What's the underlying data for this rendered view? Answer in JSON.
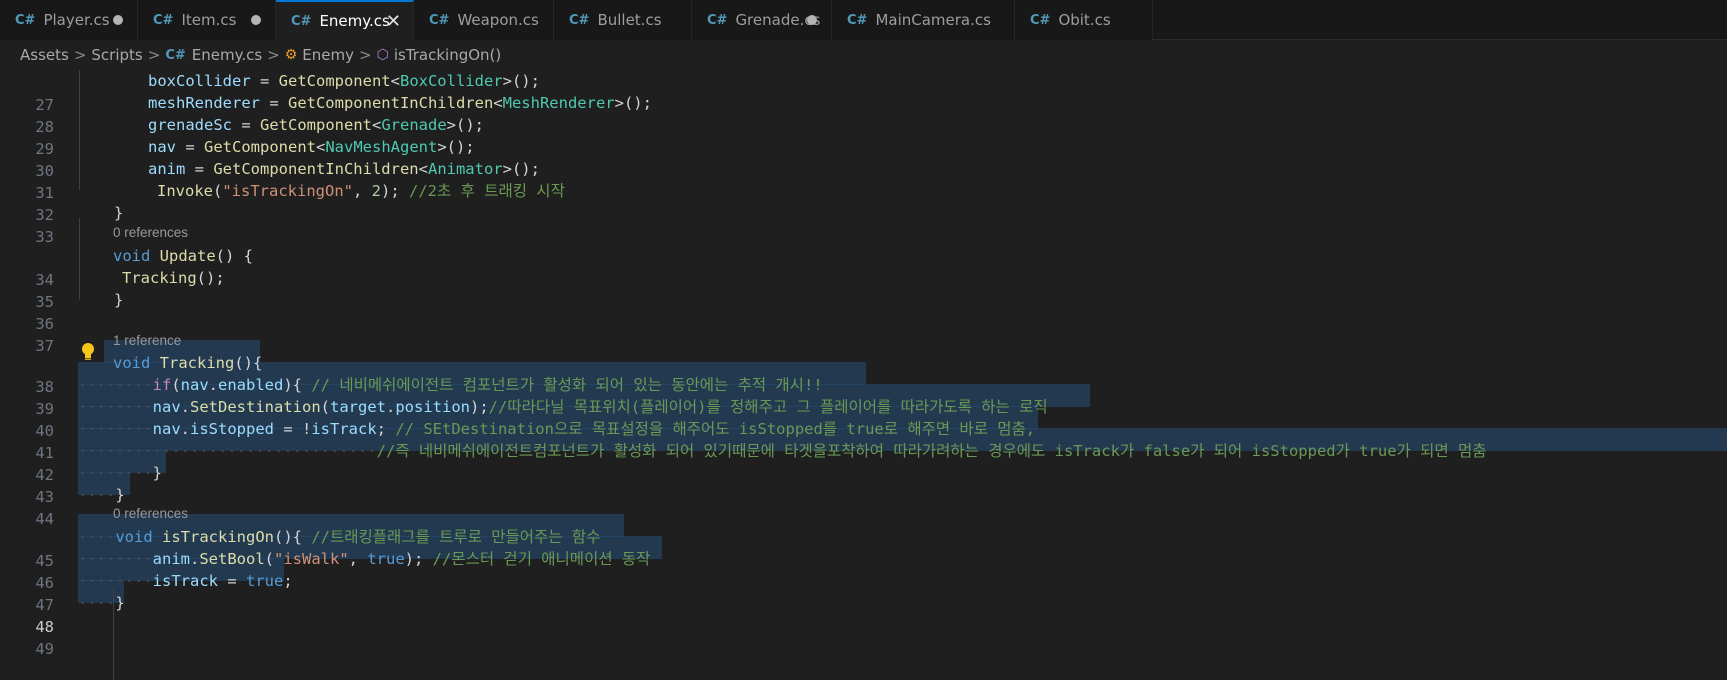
{
  "tabs": [
    {
      "label": "Player.cs",
      "state": "modified"
    },
    {
      "label": "Item.cs",
      "state": "modified"
    },
    {
      "label": "Enemy.cs",
      "state": "active"
    },
    {
      "label": "Weapon.cs",
      "state": "clean"
    },
    {
      "label": "Bullet.cs",
      "state": "clean"
    },
    {
      "label": "Grenade.cs",
      "state": "modified"
    },
    {
      "label": "MainCamera.cs",
      "state": "clean"
    },
    {
      "label": "Obit.cs",
      "state": "clean"
    }
  ],
  "breadcrumb": {
    "folder1": "Assets",
    "folder2": "Scripts",
    "file": "Enemy.cs",
    "class_name": "Enemy",
    "method": "isTrackingOn()"
  },
  "editor": {
    "current_line": "48",
    "line_numbers": {
      "l27": "27",
      "l28": "28",
      "l29": "29",
      "l30": "30",
      "l31": "31",
      "l32": "32",
      "l33": "33",
      "l34": "34",
      "l35": "35",
      "l36": "36",
      "l37": "37",
      "l38": "38",
      "l39": "39",
      "l40": "40",
      "l41": "41",
      "l42": "42",
      "l43": "43",
      "l44": "44",
      "l45": "45",
      "l46": "46",
      "l47": "47",
      "l48": "48",
      "l49": "49"
    },
    "codelens": {
      "above34": "0 references",
      "above38": "1 reference",
      "above45": "0 references"
    },
    "tokens": {
      "l27_var": "boxCollider",
      "l27_eq": " = ",
      "l27_fn": "GetComponent",
      "l27_lt": "<",
      "l27_type": "BoxCollider",
      "l27_end": ">();",
      "l28_var": "meshRenderer",
      "l28_eq": " = ",
      "l28_fn": "GetComponentInChildren",
      "l28_lt": "<",
      "l28_type": "MeshRenderer",
      "l28_end": ">();",
      "l29_var": "grenadeSc",
      "l29_eq": " = ",
      "l29_fn": "GetComponent",
      "l29_lt": "<",
      "l29_type": "Grenade",
      "l29_end": ">();",
      "l30_var": "nav",
      "l30_eq": " = ",
      "l30_fn": "GetComponent",
      "l30_lt": "<",
      "l30_type": "NavMeshAgent",
      "l30_end": ">();",
      "l31_var": "anim",
      "l31_eq": " = ",
      "l31_fn": "GetComponentInChildren",
      "l31_lt": "<",
      "l31_type": "Animator",
      "l31_end": ">();",
      "l32_fn": "Invoke",
      "l32_open": "(",
      "l32_str": "\"isTrackingOn\"",
      "l32_comma": ", ",
      "l32_num": "2",
      "l32_close": "); ",
      "l32_comment": "//2초 후 트래킹 시작",
      "l33_brace": "}",
      "l34_kw": "void",
      "l34_sp": " ",
      "l34_fn": "Update",
      "l34_rest": "() {",
      "l35_fn": "Tracking",
      "l35_rest": "();",
      "l36_brace": "}",
      "l38_kw": "void",
      "l38_sp": " ",
      "l38_fn": "Tracking",
      "l38_rest": "(){",
      "l39_ws": "········",
      "l39_kw": "if",
      "l39_open": "(",
      "l39_v1": "nav",
      "l39_dot": ".",
      "l39_v2": "enabled",
      "l39_close": "){ ",
      "l39_comment": "// 네비메쉬에이전트 컴포넌트가 활성화 되어 있는 동안에는 추적 개시!!",
      "l40_ws": "········",
      "l40_v1": "nav",
      "l40_dot": ".",
      "l40_fn": "SetDestination",
      "l40_open": "(",
      "l40_v2": "target",
      "l40_dot2": ".",
      "l40_v3": "position",
      "l40_close": ");",
      "l40_comment": "//따라다닐 목표위치(플레이어)를 정해주고 그 플레이어를 따라가도록 하는 로직",
      "l41_ws": "········",
      "l41_v1": "nav",
      "l41_dot": ".",
      "l41_v2": "isStopped",
      "l41_eq": " = !",
      "l41_v3": "isTrack",
      "l41_semi": "; ",
      "l41_comment": "// SEtDestination으로 목표설정을 해주어도 isStopped를 true로 해주면 바로 멈춤,",
      "l42_ws": "································",
      "l42_comment": "//즉 네비메쉬에이전트컴포넌트가 활성화 되어 있기때문에 타겟을포착하여 따라가려하는 경우에도 isTrack가 false가 되어 isStopped가 true가 되면 멈춤",
      "l43_ws": "········",
      "l43_brace": "}",
      "l44_ws": "····",
      "l44_brace": "}",
      "l45_ws": "····",
      "l45_kw": "void",
      "l45_sp": " ",
      "l45_fn": "isTrackingOn",
      "l45_rest": "(){ ",
      "l45_comment": "//트래킹플래그를 트루로 만들어주는 함수",
      "l46_ws": "········",
      "l46_v1": "anim",
      "l46_dot": ".",
      "l46_fn": "SetBool",
      "l46_open": "(",
      "l46_str": "\"isWalk\"",
      "l46_comma": ", ",
      "l46_kw": "true",
      "l46_close": "); ",
      "l46_comment": "//몬스터 걷기 애니메이션 동작",
      "l47_ws": "········",
      "l47_v1": "isTrack",
      "l47_eq": " = ",
      "l47_kw": "true",
      "l47_semi": ";",
      "l48_ws": "····",
      "l48_brace": "}"
    }
  },
  "colors": {
    "background": "#1f1f1f",
    "tab_active_border": "#0078d4",
    "keyword": "#569cd6",
    "control": "#c586c0",
    "type": "#4ec9b0",
    "function": "#dcdcaa",
    "variable": "#9cdcfe",
    "string": "#ce9178",
    "number": "#b5cea8",
    "comment": "#6a9955",
    "selection": "#264f78"
  },
  "icons": {
    "tab_file": "csharp-file-icon",
    "class": "class-icon",
    "method": "method-cube-icon",
    "lightbulb": "lightbulb-icon"
  }
}
